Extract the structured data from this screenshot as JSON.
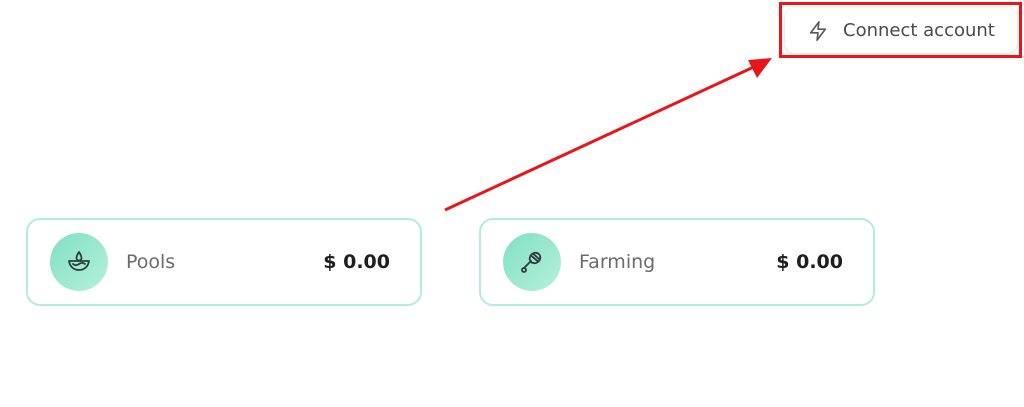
{
  "header": {
    "connect_label": "Connect account",
    "connect_icon": "bolt-icon"
  },
  "cards": [
    {
      "label": "Pools",
      "value": "$ 0.00",
      "icon": "pool-drop-icon"
    },
    {
      "label": "Farming",
      "value": "$ 0.00",
      "icon": "honey-dipper-icon"
    }
  ],
  "colors": {
    "card_border": "#b3ebe3",
    "icon_gradient_start": "#7fe0c4",
    "icon_gradient_end": "#b6f0da",
    "annotation_red": "#e8161a"
  }
}
